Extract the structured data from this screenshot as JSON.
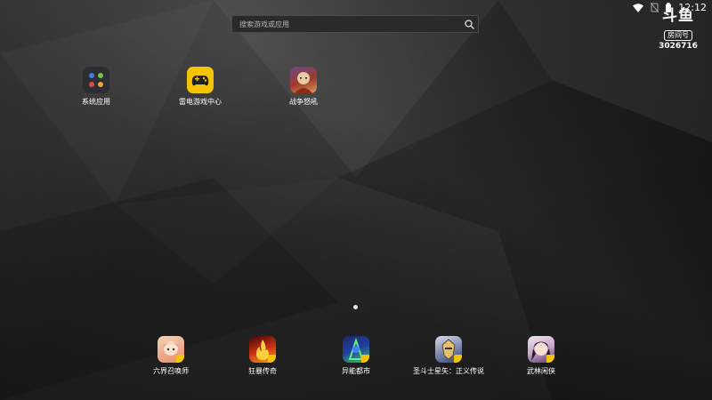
{
  "status_bar": {
    "time": "12:12"
  },
  "watermark": {
    "logo": "斗鱼",
    "badge": "房间号",
    "room": "3026716"
  },
  "search": {
    "placeholder": "搜索游戏或应用"
  },
  "top_apps": [
    {
      "label": "系统应用",
      "icon": "folder-icon"
    },
    {
      "label": "雷电游戏中心",
      "icon": "gamepad-icon"
    },
    {
      "label": "战争怒吼",
      "icon": "game-warrior-icon"
    }
  ],
  "dock_apps": [
    {
      "label": "六界召唤师",
      "icon": "game-girl-icon"
    },
    {
      "label": "狂暴传奇",
      "icon": "game-fire-icon"
    },
    {
      "label": "异能都市",
      "icon": "game-neon-icon"
    },
    {
      "label": "圣斗士星矢：正义传说",
      "icon": "game-knight-icon"
    },
    {
      "label": "武林闲侠",
      "icon": "game-swordsman-icon"
    }
  ],
  "colors": {
    "accent_yellow": "#f5c400",
    "background": "#1c1c1c"
  }
}
